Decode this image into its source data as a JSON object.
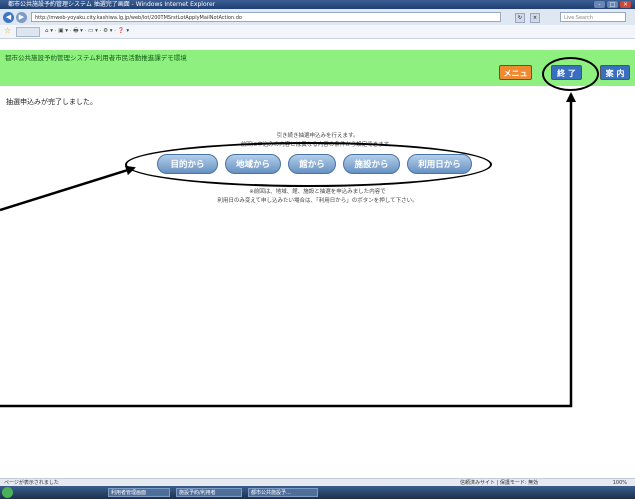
{
  "window": {
    "title": "都市公共施設予約管理システム 抽選完了画面 - Windows Internet Explorer"
  },
  "browser": {
    "url": "http://mweb-yoyaku.city.kashiwa.lg.jp/web/lot/200TMSrstLotApplyMailNotAction.do",
    "search_placeholder": "Live Search"
  },
  "app": {
    "system_name": "都市公共施設予約管理システム利用者市民活動推進課デモ環境",
    "buttons": {
      "menu": "メニュー",
      "end": "終 了",
      "help": "案 内"
    }
  },
  "main": {
    "completion_message": "抽選申込みが完了しました。",
    "info_lines": [
      "引き続き抽選申込みを行えます。",
      "前回に申込みの内容とは異なる内容の条件から設定できます。"
    ],
    "search_buttons": [
      {
        "label": "目的から"
      },
      {
        "label": "地域から"
      },
      {
        "label": "館から"
      },
      {
        "label": "施設から"
      },
      {
        "label": "利用日から"
      }
    ],
    "note_lines": [
      "※前回は、地域、館、施設と抽選を申込みました内容で",
      "利用日のみ変えて申し込みたい場合は、「利用日から」のボタンを押して下さい。"
    ]
  },
  "statusbar": {
    "left": "ページが表示されました",
    "right": "信頼済みサイト | 保護モード: 無効",
    "zoom": "100%"
  },
  "taskbar": {
    "items": [
      "利用者管理画面",
      "施設予約/利用者",
      "都市公共施設予…"
    ]
  }
}
